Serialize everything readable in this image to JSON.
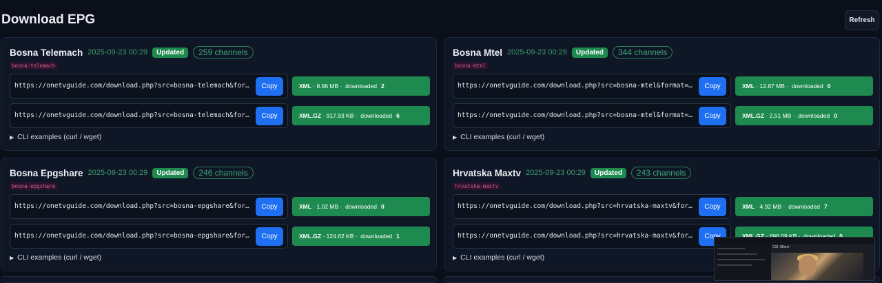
{
  "header": {
    "title": "Download EPG",
    "refresh_label": "Refresh"
  },
  "cards": [
    {
      "name": "Bosna Telemach",
      "date": "2025-09-23 00:29",
      "status": "Updated",
      "channels": "259 channels",
      "slug": "bosna-telemach",
      "rows": [
        {
          "url": "https://onetvguide.com/download.php?src=bosna-telemach&format=xml",
          "copy": "Copy",
          "format": "XML",
          "size": "8.96 MB",
          "downloaded_label": "downloaded",
          "count": "2"
        },
        {
          "url": "https://onetvguide.com/download.php?src=bosna-telemach&format=xml.gz",
          "copy": "Copy",
          "format": "XML.GZ",
          "size": "917.93 KB",
          "downloaded_label": "downloaded",
          "count": "6"
        }
      ],
      "cli_label": "CLI examples (curl / wget)"
    },
    {
      "name": "Bosna Mtel",
      "date": "2025-09-23 00:29",
      "status": "Updated",
      "channels": "344 channels",
      "slug": "bosna-mtel",
      "rows": [
        {
          "url": "https://onetvguide.com/download.php?src=bosna-mtel&format=xml",
          "copy": "Copy",
          "format": "XML",
          "size": "12.87 MB",
          "downloaded_label": "downloaded",
          "count": "0"
        },
        {
          "url": "https://onetvguide.com/download.php?src=bosna-mtel&format=xml.gz",
          "copy": "Copy",
          "format": "XML.GZ",
          "size": "2.51 MB",
          "downloaded_label": "downloaded",
          "count": "0"
        }
      ],
      "cli_label": "CLI examples (curl / wget)"
    },
    {
      "name": "Bosna Epgshare",
      "date": "2025-09-23 00:29",
      "status": "Updated",
      "channels": "246 channels",
      "slug": "bosna-epgshare",
      "rows": [
        {
          "url": "https://onetvguide.com/download.php?src=bosna-epgshare&format=xml",
          "copy": "Copy",
          "format": "XML",
          "size": "1.02 MB",
          "downloaded_label": "downloaded",
          "count": "0"
        },
        {
          "url": "https://onetvguide.com/download.php?src=bosna-epgshare&format=xml.gz",
          "copy": "Copy",
          "format": "XML.GZ",
          "size": "124.62 KB",
          "downloaded_label": "downloaded",
          "count": "1"
        }
      ],
      "cli_label": "CLI examples (curl / wget)"
    },
    {
      "name": "Hrvatska Maxtv",
      "date": "2025-09-23 00:29",
      "status": "Updated",
      "channels": "243 channels",
      "slug": "hrvatska-maxtv",
      "rows": [
        {
          "url": "https://onetvguide.com/download.php?src=hrvatska-maxtv&format=xml",
          "copy": "Copy",
          "format": "XML",
          "size": "4.92 MB",
          "downloaded_label": "downloaded",
          "count": "7"
        },
        {
          "url": "https://onetvguide.com/download.php?src=hrvatska-maxtv&format=xml.gz",
          "copy": "Copy",
          "format": "XML.GZ",
          "size": "696.09 KB",
          "downloaded_label": "downloaded",
          "count": "0"
        }
      ],
      "cli_label": "CLI examples (curl / wget)"
    }
  ],
  "overlay": {
    "title": "CSI: Miami"
  },
  "icons": {
    "cli_toggle": "triangle-right-icon"
  },
  "colors": {
    "accent": "#1f6ff2",
    "success": "#1e8a50",
    "background": "#0b0f19"
  }
}
